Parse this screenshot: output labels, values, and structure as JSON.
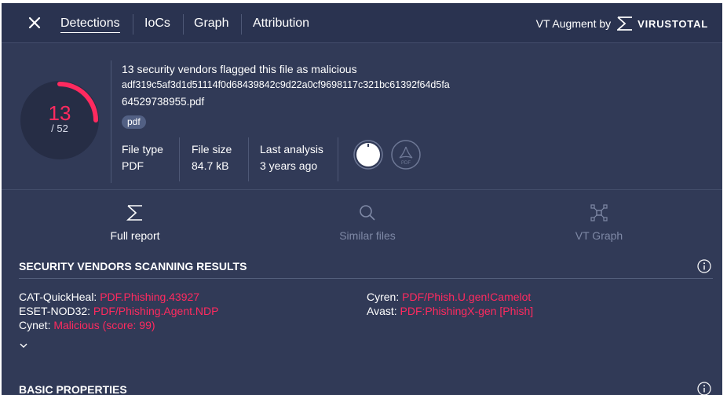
{
  "topbar": {
    "tabs": [
      {
        "label": "Detections",
        "active": true
      },
      {
        "label": "IoCs",
        "active": false
      },
      {
        "label": "Graph",
        "active": false
      },
      {
        "label": "Attribution",
        "active": false
      }
    ],
    "augment_label": "VT Augment by",
    "brand": "VIRUSTOTAL"
  },
  "summary": {
    "detections": "13",
    "total": "/ 52",
    "detection_ratio": 0.25,
    "headline": "13 security vendors flagged this file as malicious",
    "hash": "adf319c5af3d1d51114f0d68439842c9d22a0cf9698117c321bc61392f64d5fa",
    "filename": "64529738955.pdf",
    "tag": "pdf",
    "file_type_label": "File type",
    "file_type": "PDF",
    "file_size_label": "File size",
    "file_size": "84.7 kB",
    "last_analysis_label": "Last analysis",
    "last_analysis": "3 years ago",
    "icons": [
      "reputation-dial-icon",
      "pdf-file-icon"
    ]
  },
  "actions": [
    {
      "label": "Full report",
      "icon": "sigma-icon",
      "enabled": true
    },
    {
      "label": "Similar files",
      "icon": "search-icon",
      "enabled": false
    },
    {
      "label": "VT Graph",
      "icon": "graph-icon",
      "enabled": false
    }
  ],
  "vendors_section": {
    "title": "SECURITY VENDORS SCANNING RESULTS",
    "left": [
      {
        "vendor": "CAT-QuickHeal:",
        "result": "PDF.Phishing.43927"
      },
      {
        "vendor": "ESET-NOD32:",
        "result": "PDF/Phishing.Agent.NDP"
      },
      {
        "vendor": "Cynet:",
        "result": "Malicious (score: 99)"
      }
    ],
    "right": [
      {
        "vendor": "Cyren:",
        "result": "PDF/Phish.U.gen!Camelot"
      },
      {
        "vendor": "Avast:",
        "result": "PDF:PhishingX-gen [Phish]"
      }
    ]
  },
  "basic_section": {
    "title": "BASIC PROPERTIES"
  },
  "colors": {
    "background": "#313a57",
    "topbar": "#2a3350",
    "malicious": "#ff2a5f",
    "disabled": "#7f89a6"
  }
}
